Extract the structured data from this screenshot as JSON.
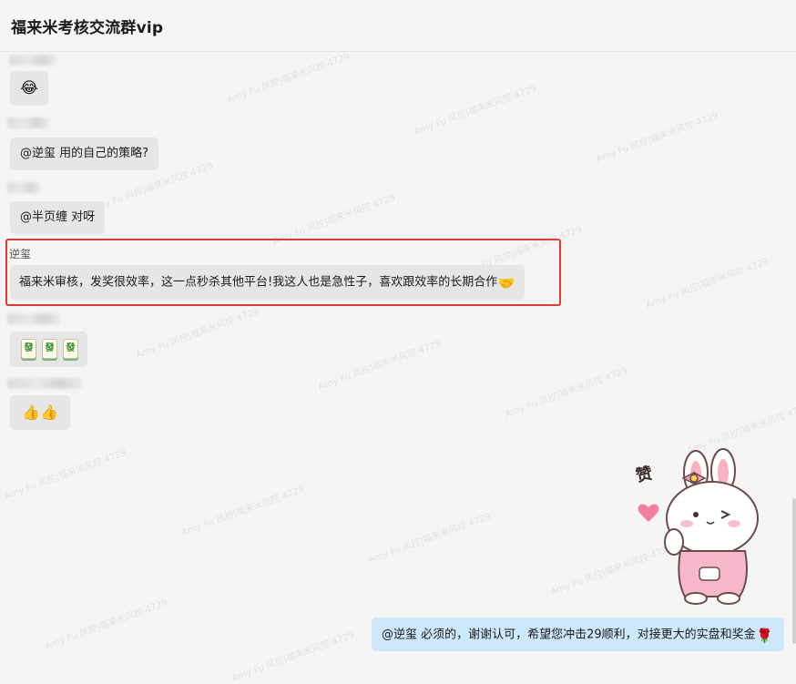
{
  "header": {
    "title": "福来米考核交流群vip"
  },
  "watermark": "Amy Fu 风控|福来米风控 4729",
  "messages": [
    {
      "text": "",
      "emoji": "😂"
    },
    {
      "text": "@逆玺  用的自己的策略?"
    },
    {
      "text": "@半页缠 对呀"
    },
    {
      "sender": "逆玺",
      "text": "福来米审核，发奖很效率，这一点秒杀其他平台!我这人也是急性子，喜欢跟效率的长期合作",
      "emoji": "🤝"
    },
    {
      "text": "",
      "tiles": [
        "發",
        "發",
        "發"
      ]
    },
    {
      "text": "",
      "emoji": "👍👍"
    },
    {
      "sticker_label": "赞"
    },
    {
      "text": "@逆玺  必须的，谢谢认可，希望您冲击29顺利，对接更大的实盘和奖金",
      "emoji": "🌹"
    }
  ],
  "colors": {
    "bubble_other": "#e6e6e6",
    "bubble_mine": "#cde7fb",
    "highlight": "#e53935",
    "background": "#f5f5f5"
  }
}
